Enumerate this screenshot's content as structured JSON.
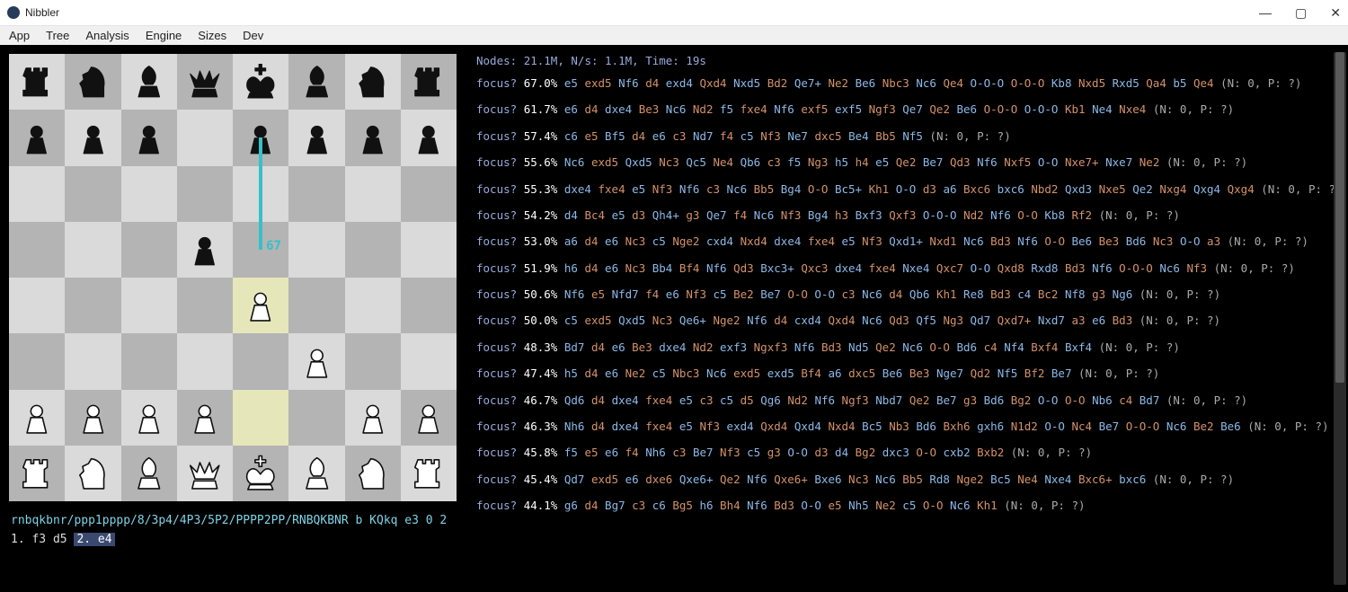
{
  "window": {
    "title": "Nibbler"
  },
  "menubar": [
    "App",
    "Tree",
    "Analysis",
    "Engine",
    "Sizes",
    "Dev"
  ],
  "board": {
    "fen_line": "rnbqkbnr/ppp1pppp/8/3p4/4P3/5P2/PPPP2PP/RNBQKBNR b KQkq e3 0 2",
    "highlights": [
      "e4",
      "e2"
    ],
    "hint": {
      "from": "e7",
      "to": "e5",
      "label": "67"
    }
  },
  "moves": {
    "prefix": "1. f3 d5 ",
    "latest": "2. e4"
  },
  "engine": {
    "stats_label": "Nodes:",
    "stats_nodes": "21.1M",
    "stats_nps_label": "N/s:",
    "stats_nps": "1.1M",
    "stats_time_label": "Time:",
    "stats_time": "19s",
    "line_prefix": "focus?",
    "line_suffix_zero": "(N: 0, P: ?)",
    "lines": [
      {
        "pct": "67.0%",
        "moves": "e5 exd5 Nf6 d4 exd4 Qxd4 Nxd5 Bd2 Qe7+ Ne2 Be6 Nbc3 Nc6 Qe4 O-O-O O-O-O Kb8 Nxd5 Rxd5 Qa4 b5 Qe4"
      },
      {
        "pct": "61.7%",
        "moves": "e6 d4 dxe4 Be3 Nc6 Nd2 f5 fxe4 Nf6 exf5 exf5 Ngf3 Qe7 Qe2 Be6 O-O-O O-O-O Kb1 Ne4 Nxe4"
      },
      {
        "pct": "57.4%",
        "moves": "c6 e5 Bf5 d4 e6 c3 Nd7 f4 c5 Nf3 Ne7 dxc5 Be4 Bb5 Nf5"
      },
      {
        "pct": "55.6%",
        "moves": "Nc6 exd5 Qxd5 Nc3 Qc5 Ne4 Qb6 c3 f5 Ng3 h5 h4 e5 Qe2 Be7 Qd3 Nf6 Nxf5 O-O Nxe7+ Nxe7 Ne2"
      },
      {
        "pct": "55.3%",
        "moves": "dxe4 fxe4 e5 Nf3 Nf6 c3 Nc6 Bb5 Bg4 O-O Bc5+ Kh1 O-O d3 a6 Bxc6 bxc6 Nbd2 Qxd3 Nxe5 Qe2 Nxg4 Qxg4 Qxg4"
      },
      {
        "pct": "54.2%",
        "moves": "d4 Bc4 e5 d3 Qh4+ g3 Qe7 f4 Nc6 Nf3 Bg4 h3 Bxf3 Qxf3 O-O-O Nd2 Nf6 O-O Kb8 Rf2"
      },
      {
        "pct": "53.0%",
        "moves": "a6 d4 e6 Nc3 c5 Nge2 cxd4 Nxd4 dxe4 fxe4 e5 Nf3 Qxd1+ Nxd1 Nc6 Bd3 Nf6 O-O Be6 Be3 Bd6 Nc3 O-O a3"
      },
      {
        "pct": "51.9%",
        "moves": "h6 d4 e6 Nc3 Bb4 Bf4 Nf6 Qd3 Bxc3+ Qxc3 dxe4 fxe4 Nxe4 Qxc7 O-O Qxd8 Rxd8 Bd3 Nf6 O-O-O Nc6 Nf3"
      },
      {
        "pct": "50.6%",
        "moves": "Nf6 e5 Nfd7 f4 e6 Nf3 c5 Be2 Be7 O-O O-O c3 Nc6 d4 Qb6 Kh1 Re8 Bd3 c4 Bc2 Nf8 g3 Ng6"
      },
      {
        "pct": "50.0%",
        "moves": "c5 exd5 Qxd5 Nc3 Qe6+ Nge2 Nf6 d4 cxd4 Qxd4 Nc6 Qd3 Qf5 Ng3 Qd7 Qxd7+ Nxd7 a3 e6 Bd3"
      },
      {
        "pct": "48.3%",
        "moves": "Bd7 d4 e6 Be3 dxe4 Nd2 exf3 Ngxf3 Nf6 Bd3 Nd5 Qe2 Nc6 O-O Bd6 c4 Nf4 Bxf4 Bxf4"
      },
      {
        "pct": "47.4%",
        "moves": "h5 d4 e6 Ne2 c5 Nbc3 Nc6 exd5 exd5 Bf4 a6 dxc5 Be6 Be3 Nge7 Qd2 Nf5 Bf2 Be7"
      },
      {
        "pct": "46.7%",
        "moves": "Qd6 d4 dxe4 fxe4 e5 c3 c5 d5 Qg6 Nd2 Nf6 Ngf3 Nbd7 Qe2 Be7 g3 Bd6 Bg2 O-O O-O Nb6 c4 Bd7"
      },
      {
        "pct": "46.3%",
        "moves": "Nh6 d4 dxe4 fxe4 e5 Nf3 exd4 Qxd4 Qxd4 Nxd4 Bc5 Nb3 Bd6 Bxh6 gxh6 N1d2 O-O Nc4 Be7 O-O-O Nc6 Be2 Be6"
      },
      {
        "pct": "45.8%",
        "moves": "f5 e5 e6 f4 Nh6 c3 Be7 Nf3 c5 g3 O-O d3 d4 Bg2 dxc3 O-O cxb2 Bxb2"
      },
      {
        "pct": "45.4%",
        "moves": "Qd7 exd5 e6 dxe6 Qxe6+ Qe2 Nf6 Qxe6+ Bxe6 Nc3 Nc6 Bb5 Rd8 Nge2 Bc5 Ne4 Nxe4 Bxc6+ bxc6"
      },
      {
        "pct": "44.1%",
        "moves": "g6 d4 Bg7 c3 c6 Bg5 h6 Bh4 Nf6 Bd3 O-O e5 Nh5 Ne2 c5 O-O Nc6 Kh1"
      }
    ]
  },
  "pieces": {
    "a8": "br",
    "b8": "bn",
    "c8": "bb",
    "d8": "bq",
    "e8": "bk",
    "f8": "bb",
    "g8": "bn",
    "h8": "br",
    "a7": "bp",
    "b7": "bp",
    "c7": "bp",
    "e7": "bp",
    "f7": "bp",
    "g7": "bp",
    "h7": "bp",
    "d5": "bp",
    "e4": "wp",
    "f3": "wp",
    "a2": "wp",
    "b2": "wp",
    "c2": "wp",
    "d2": "wp",
    "g2": "wp",
    "h2": "wp",
    "a1": "wr",
    "b1": "wn",
    "c1": "wb",
    "d1": "wq",
    "e1": "wk",
    "f1": "wb",
    "g1": "wn",
    "h1": "wr"
  }
}
